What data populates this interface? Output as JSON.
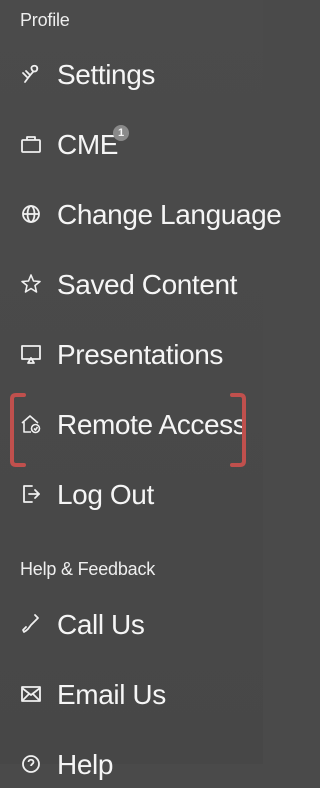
{
  "sections": [
    {
      "title": "Profile",
      "items": [
        {
          "label": "Settings",
          "icon": "settings-icon"
        },
        {
          "label": "CME",
          "icon": "cme-icon",
          "badge": "1"
        },
        {
          "label": "Change Language",
          "icon": "globe-icon"
        },
        {
          "label": "Saved Content",
          "icon": "star-icon"
        },
        {
          "label": "Presentations",
          "icon": "presentation-icon"
        },
        {
          "label": "Remote Access",
          "icon": "remote-access-icon"
        },
        {
          "label": "Log Out",
          "icon": "log-out-icon"
        }
      ]
    },
    {
      "title": "Help & Feedback",
      "items": [
        {
          "label": "Call Us",
          "icon": "phone-icon"
        },
        {
          "label": "Email Us",
          "icon": "email-icon"
        },
        {
          "label": "Help",
          "icon": "help-icon"
        }
      ]
    }
  ],
  "colors": {
    "background": "#4a4a4a",
    "text": "#f5f5f5",
    "highlight_border": "#c0504d",
    "badge": "#8a8a8a"
  }
}
